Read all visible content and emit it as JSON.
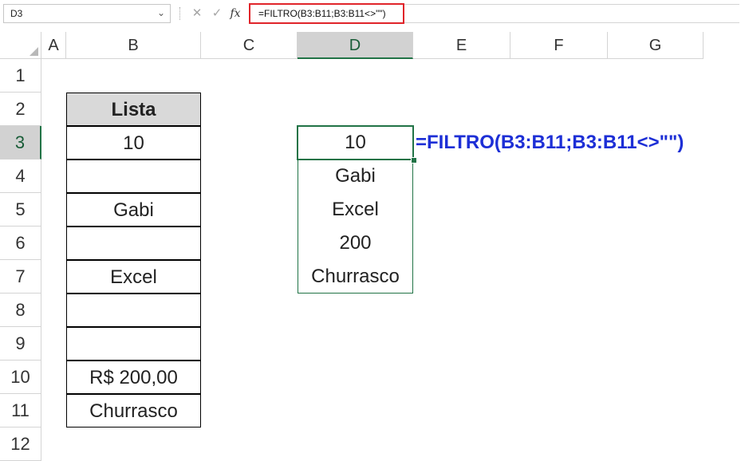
{
  "name_box": {
    "value": "D3"
  },
  "formula_bar": {
    "cancel_icon": "close-icon",
    "enter_icon": "check-icon",
    "fx_label": "fx",
    "formula": "=FILTRO(B3:B11;B3:B11<>\"\")"
  },
  "columns": [
    "A",
    "B",
    "C",
    "D",
    "E",
    "F",
    "G"
  ],
  "rows": [
    "1",
    "2",
    "3",
    "4",
    "5",
    "6",
    "7",
    "8",
    "9",
    "10",
    "11",
    "12"
  ],
  "active_cell": {
    "column": "D",
    "row": "3"
  },
  "list": {
    "header": "Lista",
    "values": [
      "10",
      "",
      "Gabi",
      "",
      "Excel",
      "",
      "",
      "R$ 200,00",
      "Churrasco"
    ]
  },
  "result": {
    "values": [
      "10",
      "Gabi",
      "Excel",
      "200",
      "Churrasco"
    ]
  },
  "annotation": "=FILTRO(B3:B11;B3:B11<>\"\")",
  "colors": {
    "accent_green": "#217346",
    "highlight_red": "#e0242a",
    "annotation_blue": "#1d2fd6",
    "header_gray": "#d9d9d9"
  }
}
